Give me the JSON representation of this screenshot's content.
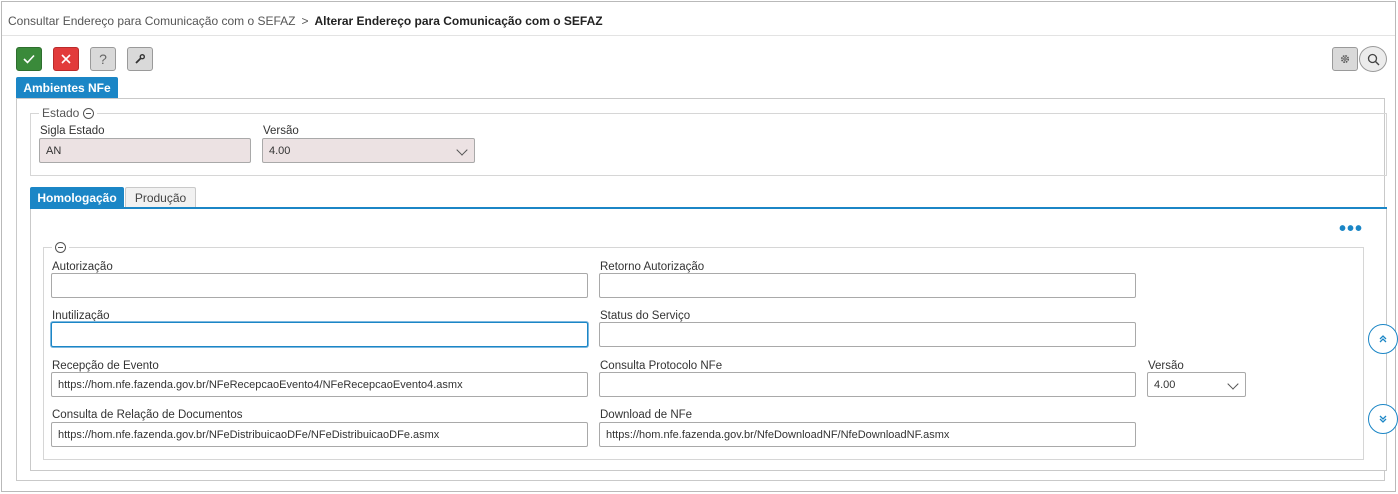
{
  "breadcrumb": {
    "parent": "Consultar Endereço para Comunicação com o SEFAZ",
    "separator": ">",
    "current": "Alterar Endereço para Comunicação com o SEFAZ"
  },
  "toolbar": {
    "confirm_icon": "check-icon",
    "cancel_icon": "close-icon",
    "help_label": "?",
    "tools_icon": "wrench-icon",
    "settings_icon": "gear-icon",
    "search_icon": "search-icon"
  },
  "colors": {
    "accent": "#1b86c6",
    "confirm": "#3a8a3a",
    "cancel": "#e23b3b",
    "readonly_bg": "#ece2e3"
  },
  "main_tab": {
    "label": "Ambientes NFe"
  },
  "estado": {
    "legend": "Estado",
    "sigla_label": "Sigla Estado",
    "sigla_value": "AN",
    "versao_label": "Versão",
    "versao_value": "4.00"
  },
  "subtabs": [
    {
      "label": "Homologação",
      "active": true
    },
    {
      "label": "Produção",
      "active": false
    }
  ],
  "fields": {
    "autorizacao": {
      "label": "Autorização",
      "value": ""
    },
    "retorno_autorizacao": {
      "label": "Retorno Autorização",
      "value": ""
    },
    "inutilizacao": {
      "label": "Inutilização",
      "value": ""
    },
    "status_servico": {
      "label": "Status do Serviço",
      "value": ""
    },
    "recepcao_evento": {
      "label": "Recepção de Evento",
      "value": "https://hom.nfe.fazenda.gov.br/NFeRecepcaoEvento4/NFeRecepcaoEvento4.asmx"
    },
    "consulta_protocolo": {
      "label": "Consulta Protocolo NFe",
      "value": ""
    },
    "versao": {
      "label": "Versão",
      "value": "4.00"
    },
    "consulta_relacao": {
      "label": "Consulta de Relação de Documentos",
      "value": "https://hom.nfe.fazenda.gov.br/NFeDistribuicaoDFe/NFeDistribuicaoDFe.asmx"
    },
    "download_nfe": {
      "label": "Download de NFe",
      "value": "https://hom.nfe.fazenda.gov.br/NfeDownloadNF/NfeDownloadNF.asmx"
    }
  },
  "more_label": "•••"
}
